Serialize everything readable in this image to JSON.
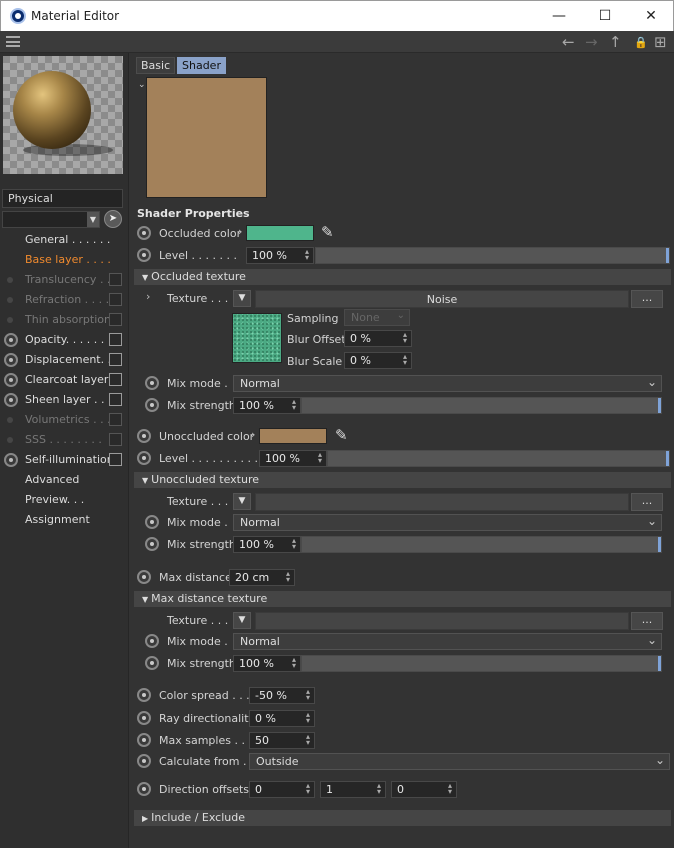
{
  "window": {
    "title": "Material Editor",
    "minimize": "—",
    "maximize": "☐",
    "close": "✕"
  },
  "toolbar": {
    "back": "←",
    "forward": "→",
    "up": "↑",
    "lock": "🔒",
    "new": "⊞"
  },
  "left": {
    "material_name": "Physical",
    "nav": [
      {
        "label": "General . . . . . .",
        "state": "normal",
        "checkbox": false,
        "radio": false
      },
      {
        "label": "Base layer . . . .",
        "state": "active",
        "checkbox": false,
        "radio": false
      },
      {
        "label": "Translucency . . .",
        "state": "dim",
        "checkbox": true,
        "radio": false
      },
      {
        "label": "Refraction . . . .",
        "state": "dim",
        "checkbox": true,
        "radio": false
      },
      {
        "label": "Thin absorption",
        "state": "dim",
        "checkbox": true,
        "radio": false
      },
      {
        "label": "Opacity. . . . . .",
        "state": "normal",
        "checkbox": true,
        "radio": true
      },
      {
        "label": "Displacement. . .",
        "state": "normal",
        "checkbox": true,
        "radio": true
      },
      {
        "label": "Clearcoat layer",
        "state": "normal",
        "checkbox": true,
        "radio": true
      },
      {
        "label": "Sheen layer . . .",
        "state": "normal",
        "checkbox": true,
        "radio": true
      },
      {
        "label": "Volumetrics . . .",
        "state": "dim",
        "checkbox": true,
        "radio": false
      },
      {
        "label": "SSS  . . . . . . . .",
        "state": "dim",
        "checkbox": true,
        "radio": false
      },
      {
        "label": "Self-illumination",
        "state": "normal",
        "checkbox": true,
        "radio": true
      },
      {
        "label": "Advanced",
        "state": "normal",
        "checkbox": false,
        "radio": false
      },
      {
        "label": "Preview. . .",
        "state": "normal",
        "checkbox": false,
        "radio": false
      },
      {
        "label": "Assignment",
        "state": "normal",
        "checkbox": false,
        "radio": false
      }
    ]
  },
  "tabs": {
    "basic": "Basic",
    "shader": "Shader"
  },
  "shader": {
    "heading": "Shader Properties",
    "occluded_color_label": "Occluded color",
    "occluded_color": "#4fb58c",
    "level_label": "Level  . . . . . . .",
    "level_value": "100 %",
    "occluded_texture_group": "Occluded texture",
    "texture_label": "Texture . . .",
    "texture_name": "Noise",
    "more_btn": "...",
    "sampling_label": "Sampling",
    "sampling_value": "None",
    "blur_offset_label": "Blur Offset",
    "blur_offset_value": "0 %",
    "blur_scale_label": "Blur Scale",
    "blur_scale_value": "0 %",
    "mix_mode_label": "Mix mode .",
    "mix_mode_value": "Normal",
    "mix_strength_label": "Mix strength",
    "mix_strength_value": "100 %",
    "unoccluded_color_label": "Unoccluded color",
    "unoccluded_color": "#a3815a",
    "level2_label": "Level  . . . . . . . . . .",
    "level2_value": "100 %",
    "unoccluded_texture_group": "Unoccluded texture",
    "max_distance_label": "Max distance",
    "max_distance_value": "20 cm",
    "max_distance_texture_group": "Max distance texture",
    "color_spread_label": "Color spread  . . .",
    "color_spread_value": "-50 %",
    "ray_dir_label": "Ray directionality",
    "ray_dir_value": "0 %",
    "max_samples_label": "Max samples  . . .",
    "max_samples_value": "50",
    "calc_from_label": "Calculate from . .",
    "calc_from_value": "Outside",
    "dir_offsets_label": "Direction offsets",
    "dir_x": "0",
    "dir_y": "1",
    "dir_z": "0",
    "include_group": "Include / Exclude"
  },
  "colors": {
    "shader_preview": "#a3815a",
    "active_nav": "#f08a2e",
    "tab_selected": "#8aa2c9"
  }
}
